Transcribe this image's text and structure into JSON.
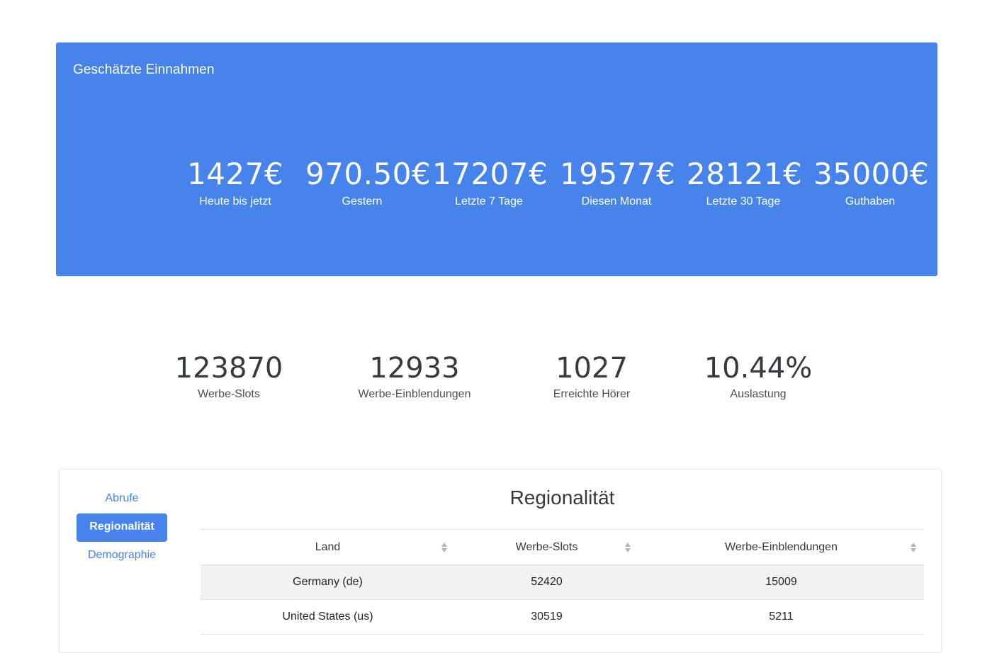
{
  "revenue": {
    "title": "Geschätzte Einnahmen",
    "stats": [
      {
        "value": "1427€",
        "label": "Heute bis jetzt"
      },
      {
        "value": "970.50€",
        "label": "Gestern"
      },
      {
        "value": "17207€",
        "label": "Letzte 7 Tage"
      },
      {
        "value": "19577€",
        "label": "Diesen Monat"
      },
      {
        "value": "28121€",
        "label": "Letzte 30 Tage"
      },
      {
        "value": "35000€",
        "label": "Guthaben"
      }
    ]
  },
  "kpis": [
    {
      "value": "123870",
      "label": "Werbe-Slots"
    },
    {
      "value": "12933",
      "label": "Werbe-Einblendungen"
    },
    {
      "value": "1027",
      "label": "Erreichte Hörer"
    },
    {
      "value": "10.44%",
      "label": "Auslastung"
    }
  ],
  "nav": {
    "items": [
      {
        "label": "Abrufe",
        "active": false
      },
      {
        "label": "Regionalität",
        "active": true
      },
      {
        "label": "Demographie",
        "active": false
      }
    ]
  },
  "region": {
    "title": "Regionalität",
    "columns": [
      "Land",
      "Werbe-Slots",
      "Werbe-Einblendungen"
    ],
    "rows": [
      [
        "Germany (de)",
        "52420",
        "15009"
      ],
      [
        "United States (us)",
        "30519",
        "5211"
      ]
    ]
  },
  "colors": {
    "accent": "#4683ea",
    "text": "#343a40",
    "stripe": "#f2f2f2"
  }
}
